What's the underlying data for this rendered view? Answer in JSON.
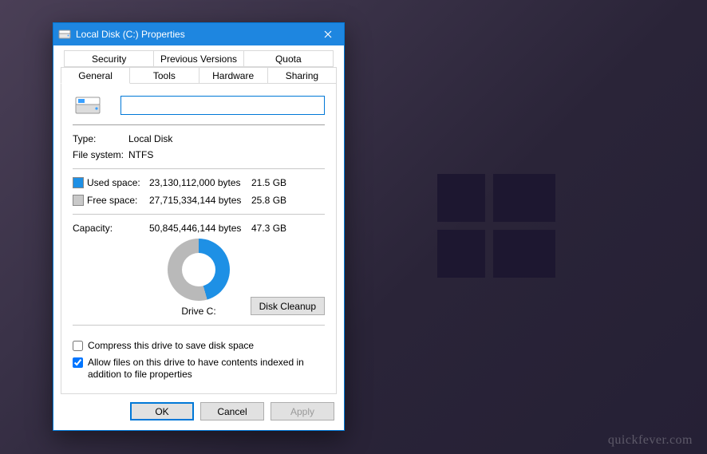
{
  "window": {
    "title": "Local Disk (C:) Properties",
    "close_icon_name": "close-icon"
  },
  "tabs": {
    "row1": [
      "Security",
      "Previous Versions",
      "Quota"
    ],
    "row2": [
      "General",
      "Tools",
      "Hardware",
      "Sharing"
    ],
    "active": "General"
  },
  "general": {
    "name_value": "",
    "type_label": "Type:",
    "type_value": "Local Disk",
    "fs_label": "File system:",
    "fs_value": "NTFS",
    "used_label": "Used space:",
    "used_bytes": "23,130,112,000 bytes",
    "used_human": "21.5 GB",
    "free_label": "Free space:",
    "free_bytes": "27,715,334,144 bytes",
    "free_human": "25.8 GB",
    "capacity_label": "Capacity:",
    "capacity_bytes": "50,845,446,144 bytes",
    "capacity_human": "47.3 GB",
    "drive_caption": "Drive C:",
    "cleanup_button": "Disk Cleanup",
    "compress_label": "Compress this drive to save disk space",
    "index_label": "Allow files on this drive to have contents indexed in addition to file properties"
  },
  "buttons": {
    "ok": "OK",
    "cancel": "Cancel",
    "apply": "Apply"
  },
  "watermark": "quickfever.com",
  "chart_data": {
    "type": "pie",
    "title": "Drive C:",
    "series": [
      {
        "name": "Used space",
        "value_bytes": 23130112000,
        "value_human": "21.5 GB",
        "color": "#1e90e5"
      },
      {
        "name": "Free space",
        "value_bytes": 27715334144,
        "value_human": "25.8 GB",
        "color": "#b9b9b9"
      }
    ],
    "total": {
      "label": "Capacity",
      "value_bytes": 50845446144,
      "value_human": "47.3 GB"
    }
  }
}
